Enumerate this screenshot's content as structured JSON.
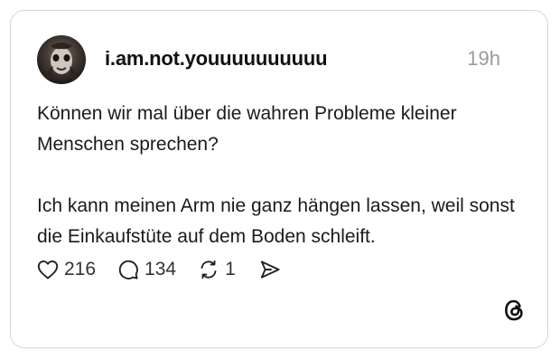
{
  "post": {
    "username": "i.am.not.youuuuuuuuuu",
    "time": "19h",
    "paragraphs": [
      "Können wir mal über die wahren Probleme kleiner Menschen sprechen?",
      "Ich kann meinen Arm nie ganz hängen lassen, weil sonst die Einkaufstüte auf dem Boden schleift."
    ]
  },
  "actions": {
    "likes": "216",
    "replies": "134",
    "reposts": "1"
  },
  "icons": {
    "like": "heart-icon",
    "reply": "comment-bubble-icon",
    "repost": "repost-arrows-icon",
    "share": "send-icon",
    "brand": "threads-logo-icon"
  },
  "colors": {
    "text": "#111111",
    "muted": "#9a9a9a",
    "border": "#d6d6d6"
  }
}
